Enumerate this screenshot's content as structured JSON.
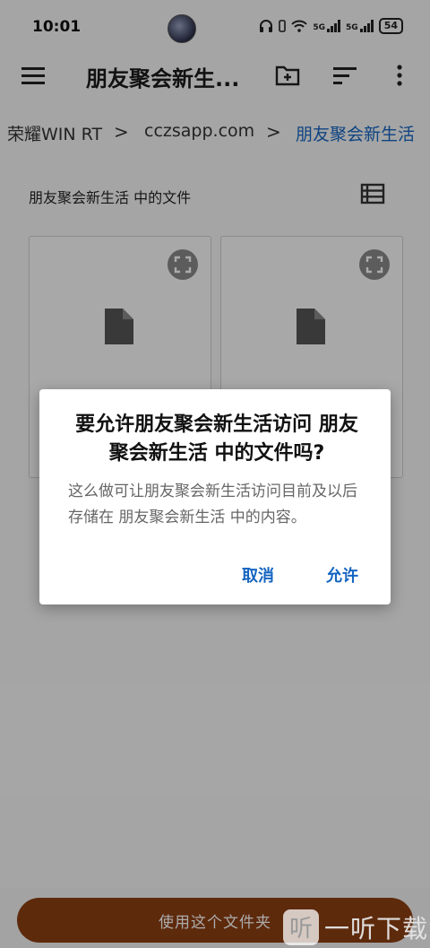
{
  "status_bar": {
    "time": "10:01",
    "battery": "54",
    "network_tag": "5G"
  },
  "toolbar": {
    "title": "朋友聚会新生..."
  },
  "breadcrumb": {
    "items": [
      "荣耀WIN RT",
      "cczsapp.com",
      "朋友聚会新生活"
    ],
    "separator": ">"
  },
  "main": {
    "section_label": "朋友聚会新生活 中的文件"
  },
  "dialog": {
    "title": "要允许朋友聚会新生活访问 朋友聚会新生活 中的文件吗?",
    "message": "这么做可让朋友聚会新生活访问目前及以后存储在 朋友聚会新生活 中的内容。",
    "cancel_label": "取消",
    "allow_label": "允许"
  },
  "bottom": {
    "use_folder_label": "使用这个文件夹"
  },
  "watermark": {
    "logo_char": "听",
    "text": "一听下载"
  },
  "colors": {
    "accent": "#1565c0",
    "primary_button": "#8c3f12",
    "scrim": "rgba(0,0,0,0.33)"
  },
  "icons": [
    "menu-icon",
    "new-folder-icon",
    "sort-icon",
    "more-vert-icon",
    "list-view-icon",
    "expand-icon",
    "file-icon",
    "wifi-icon",
    "headphones-icon"
  ]
}
